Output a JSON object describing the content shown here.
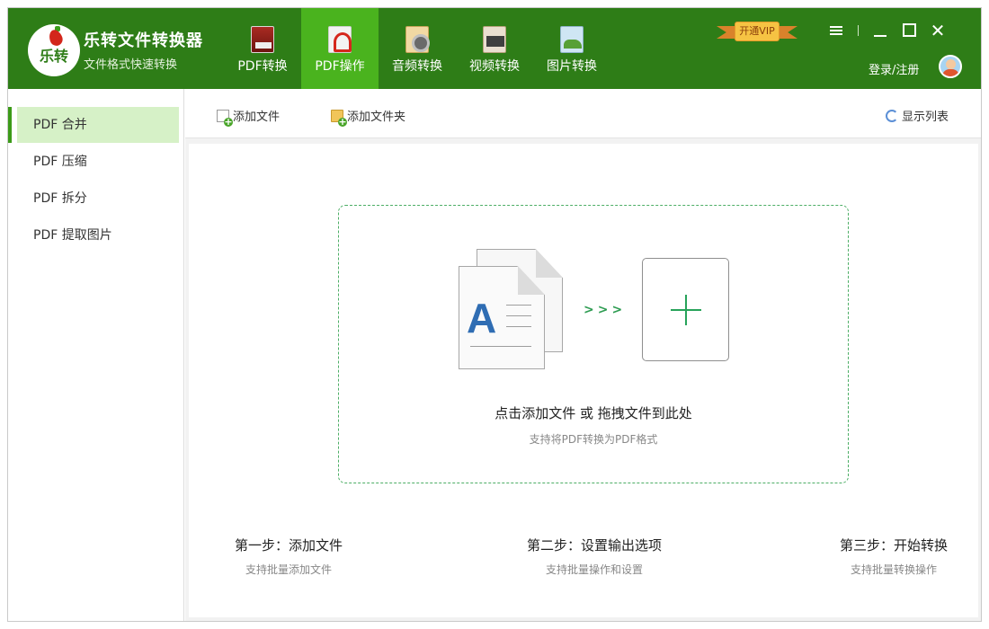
{
  "app": {
    "title": "乐转文件转换器",
    "subtitle": "文件格式快速转换",
    "logo_text": "乐转"
  },
  "nav": {
    "items": [
      {
        "label": "PDF转换",
        "icon": "pdf-document-icon",
        "active": false
      },
      {
        "label": "PDF操作",
        "icon": "adobe-pdf-icon",
        "active": true
      },
      {
        "label": "音频转换",
        "icon": "wav-audio-icon",
        "active": false
      },
      {
        "label": "视频转换",
        "icon": "avi-video-icon",
        "active": false
      },
      {
        "label": "图片转换",
        "icon": "image-icon",
        "active": false
      }
    ]
  },
  "header": {
    "vip_label": "开通VIP",
    "login_label": "登录/注册"
  },
  "sidebar": {
    "items": [
      {
        "label": "PDF 合并",
        "active": true
      },
      {
        "label": "PDF 压缩",
        "active": false
      },
      {
        "label": "PDF 拆分",
        "active": false
      },
      {
        "label": "PDF 提取图片",
        "active": false
      }
    ]
  },
  "toolbar": {
    "add_file": "添加文件",
    "add_folder": "添加文件夹",
    "show_list": "显示列表"
  },
  "dropzone": {
    "doc_letter": "A",
    "arrows": ">>>",
    "main_text": "点击添加文件 或 拖拽文件到此处",
    "sub_text": "支持将PDF转换为PDF格式"
  },
  "steps": [
    {
      "title": "第一步：添加文件",
      "desc": "支持批量添加文件"
    },
    {
      "title": "第二步：设置输出选项",
      "desc": "支持批量操作和设置"
    },
    {
      "title": "第三步：开始转换",
      "desc": "支持批量转换操作"
    }
  ],
  "colors": {
    "header_bg": "#2e7d17",
    "nav_active": "#4ab31e",
    "sidebar_active": "#d6f1c7",
    "accent_green": "#27a35a"
  }
}
